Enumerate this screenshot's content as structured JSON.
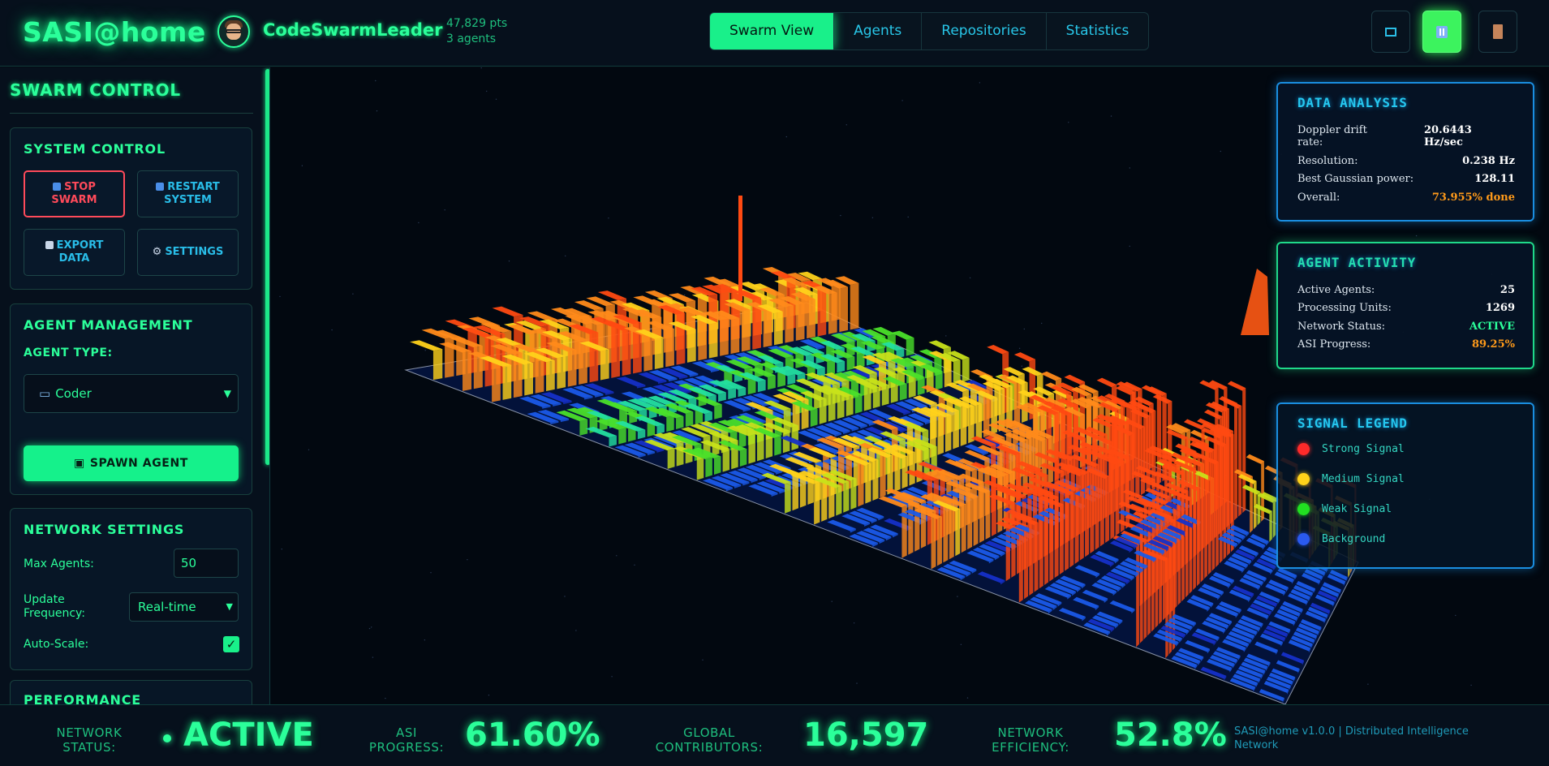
{
  "app": {
    "logo": "SASI@home",
    "username": "CodeSwarmLeader",
    "points": "47,829 pts",
    "agents": "3 agents"
  },
  "nav": {
    "tabs": [
      {
        "label": "Swarm View",
        "active": true
      },
      {
        "label": "Agents",
        "active": false
      },
      {
        "label": "Repositories",
        "active": false
      },
      {
        "label": "Statistics",
        "active": false
      }
    ]
  },
  "header_buttons": [
    {
      "icon": "window-icon"
    },
    {
      "icon": "pause-icon"
    },
    {
      "icon": "door-icon"
    }
  ],
  "sidebar": {
    "title": "SWARM CONTROL",
    "system_control": {
      "title": "SYSTEM CONTROL",
      "stop": [
        "STOP",
        "SWARM"
      ],
      "restart": [
        "RESTART",
        "SYSTEM"
      ],
      "export": [
        "EXPORT",
        "DATA"
      ],
      "settings": "SETTINGS"
    },
    "agent_management": {
      "title": "AGENT MANAGEMENT",
      "type_label": "AGENT TYPE:",
      "selected_type": "Coder",
      "spawn": "SPAWN AGENT"
    },
    "network_settings": {
      "title": "NETWORK SETTINGS",
      "max_agents_label": "Max Agents:",
      "max_agents": "50",
      "update_label": "Update Frequency:",
      "update_value": "Real-time",
      "auto_scale_label": "Auto-Scale:",
      "auto_scale": true
    },
    "performance_title": "PERFORMANCE"
  },
  "data_analysis": {
    "title": "DATA ANALYSIS",
    "rows": [
      {
        "label": "Doppler drift rate:",
        "value": "20.6443 Hz/sec"
      },
      {
        "label": "Resolution:",
        "value": "0.238 Hz"
      },
      {
        "label": "Best Gaussian power:",
        "value": "128.11"
      },
      {
        "label": "Overall:",
        "value": "73.955% done"
      }
    ]
  },
  "agent_activity": {
    "title": "AGENT ACTIVITY",
    "rows": [
      {
        "label": "Active Agents:",
        "value": "25"
      },
      {
        "label": "Processing Units:",
        "value": "1269"
      },
      {
        "label": "Network Status:",
        "value": "ACTIVE"
      },
      {
        "label": "ASI Progress:",
        "value": "89.25%"
      }
    ]
  },
  "signal_legend": {
    "title": "SIGNAL LEGEND",
    "items": [
      {
        "label": "Strong Signal",
        "color": "#ff2a2a"
      },
      {
        "label": "Medium Signal",
        "color": "#ffd21a"
      },
      {
        "label": "Weak Signal",
        "color": "#21e021"
      },
      {
        "label": "Background",
        "color": "#2a5af0"
      }
    ]
  },
  "footer": {
    "network_status_label": [
      "NETWORK",
      "STATUS:"
    ],
    "network_status": "ACTIVE",
    "asi_label": [
      "ASI",
      "PROGRESS:"
    ],
    "asi_progress": "61.60%",
    "contributors_label": [
      "GLOBAL",
      "CONTRIBUTORS:"
    ],
    "contributors": "16,597",
    "efficiency_label": [
      "NETWORK",
      "EFFICIENCY:"
    ],
    "efficiency": "52.8%",
    "credit": "SASI@home v1.0.0 | Distributed Intelligence Network"
  },
  "colors": {
    "accent": "#2bff9a",
    "cyan": "#25c8f0",
    "warning": "#ff9a1a",
    "danger": "#ff4a5a"
  }
}
